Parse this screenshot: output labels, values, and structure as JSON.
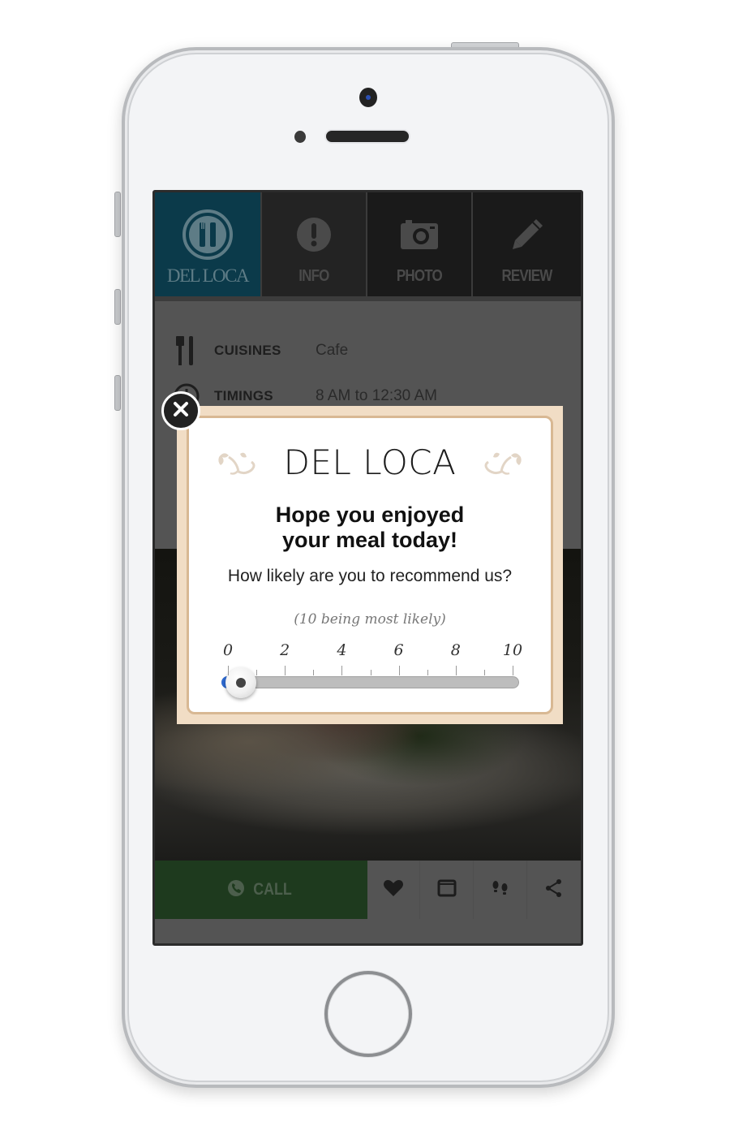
{
  "app": {
    "tabs": [
      {
        "label": "DEL LOCA",
        "icon": "fork-knife-plate-icon",
        "active": true
      },
      {
        "label": "INFO",
        "icon": "exclamation-circle-icon",
        "active": false
      },
      {
        "label": "PHOTO",
        "icon": "camera-icon",
        "active": false
      },
      {
        "label": "REVIEW",
        "icon": "pencil-icon",
        "active": false
      }
    ],
    "info": [
      {
        "label": "CUISINES",
        "value": "Cafe",
        "icon": "fork-knife-icon"
      },
      {
        "label": "TIMINGS",
        "value": "8 AM to 12:30 AM",
        "icon": "clock-icon"
      }
    ],
    "bottom_bar": {
      "call_label": "CALL",
      "call_icon": "phone-icon",
      "icons": [
        "heart-icon",
        "calendar-icon",
        "footsteps-icon",
        "share-icon"
      ]
    }
  },
  "popup": {
    "brand": "DEL LOCA",
    "headline_line1": "Hope you enjoyed",
    "headline_line2": "your meal today!",
    "question": "How likely are you to recommend us?",
    "hint": "(10 being most likely)",
    "slider": {
      "min": 0,
      "max": 10,
      "value": 0,
      "tick_labels": [
        "0",
        "2",
        "4",
        "6",
        "8",
        "10"
      ]
    },
    "close_icon": "close-icon"
  },
  "colors": {
    "active_tab": "#0b3a4a",
    "call_button": "#1e3a1e",
    "popup_frame": "#f1ddc5",
    "popup_border": "#d8b893",
    "slider_fill": "#2e6ad1"
  }
}
